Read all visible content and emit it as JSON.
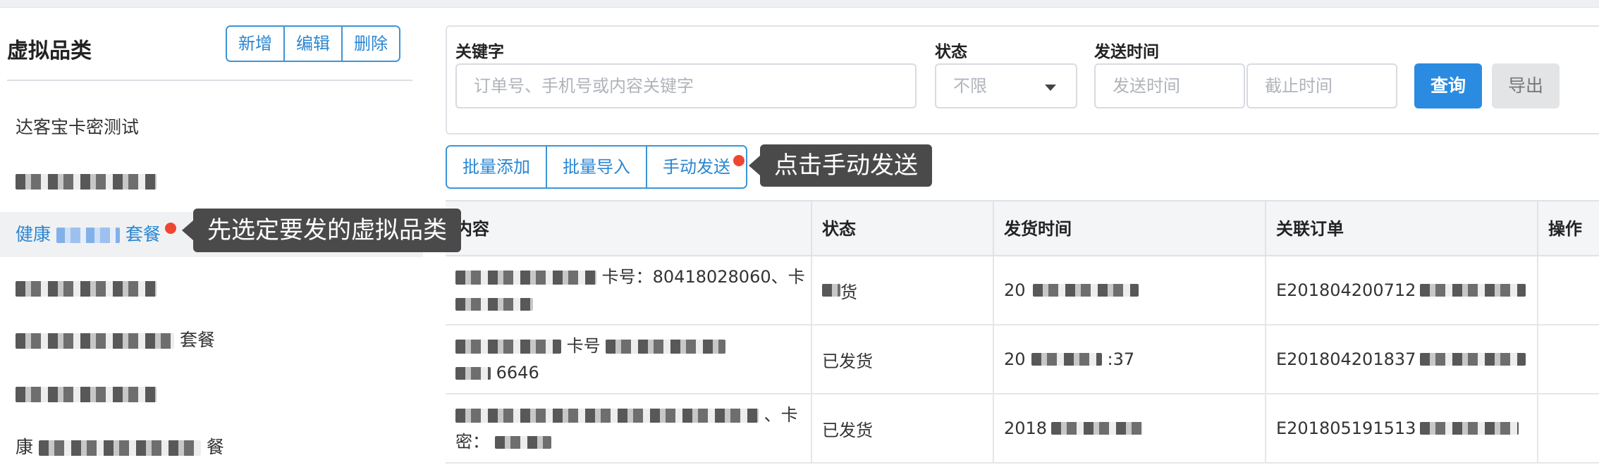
{
  "left_panel": {
    "title": "虚拟品类",
    "buttons": {
      "add": "新增",
      "edit": "编辑",
      "delete": "删除"
    },
    "categories": [
      {
        "label": "达客宝卡密测试",
        "active": false
      },
      {
        "label": "",
        "active": false
      },
      {
        "label_prefix": "健康",
        "label_suffix": "套餐",
        "active": true
      },
      {
        "label": "",
        "active": false
      },
      {
        "label_suffix": "套餐",
        "active": false
      },
      {
        "label": "",
        "active": false
      },
      {
        "label_prefix": "康",
        "label_suffix": "餐",
        "active": false
      }
    ],
    "tooltip": "先选定要发的虚拟品类"
  },
  "filter": {
    "keyword_label": "关键字",
    "keyword_placeholder": "订单号、手机号或内容关键字",
    "status_label": "状态",
    "status_value": "不限",
    "time_label": "发送时间",
    "time_start_placeholder": "发送时间",
    "time_end_placeholder": "截止时间",
    "query_button": "查询",
    "export_button": "导出"
  },
  "actions": {
    "batch_add": "批量添加",
    "batch_import": "批量导入",
    "manual_send": "手动发送",
    "tooltip": "点击手动发送"
  },
  "table": {
    "columns": [
      "内容",
      "状态",
      "发货时间",
      "关联订单",
      "操作"
    ],
    "rows": [
      {
        "content_a": "卡号：80418028060、卡",
        "status": "货",
        "time": "20",
        "order": "E201804200712"
      },
      {
        "content_a": "卡号",
        "content_b": "6646",
        "status": "已发货",
        "time": "20",
        "time_suffix": ":37",
        "order": "E201804201837"
      },
      {
        "content_a": "、卡",
        "content_b": "密：",
        "status": "已发货",
        "time": "2018",
        "order": "E201805191513"
      }
    ]
  },
  "colors": {
    "accent": "#2a86d1",
    "primary_button": "#2a8be0",
    "tooltip_bg": "#4a4a4a",
    "marker_dot": "#ef4631"
  }
}
